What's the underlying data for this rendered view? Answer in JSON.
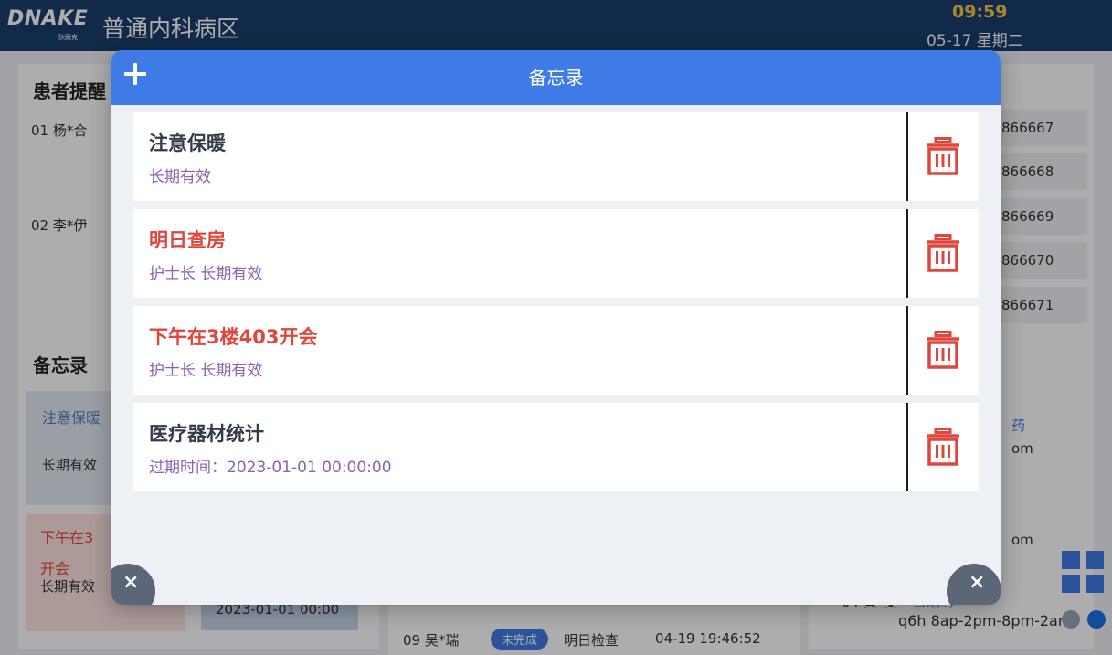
{
  "app": {
    "brand": "DNAKE",
    "brand_sub": "狄耐克",
    "ward_name": "普通内科病区",
    "time": "09:59",
    "date": "05-17 星期二"
  },
  "background": {
    "patient_section_title": "患者提醒",
    "patients": [
      "01 杨*合",
      "02 李*伊"
    ],
    "phones": [
      "866667",
      "866668",
      "866669",
      "866670",
      "866671"
    ],
    "memo_section_title": "备忘录",
    "memo_1_title": "注意保暖",
    "memo_1_sub": "长期有效",
    "memo_2_title_a": "下午在3",
    "memo_2_title_b": "开会",
    "memo_2_sub": "长期有效",
    "memo_2_time": "2023-01-01 00:00",
    "bed_row_name": "09 吴*瑞",
    "bed_row_status": "未完成",
    "bed_row_task": "明日检查",
    "bed_row_time": "04-19 19:46:52",
    "right_row_name": "04 黄*斐",
    "right_row_tag": "日晒药",
    "right_row_schedule": "q6h  8ap-2pm-8pm-2am",
    "right_pm_1": "om",
    "right_pm_2": "om",
    "right_tag_partial": "药"
  },
  "modal": {
    "title": "备忘录",
    "add_label": "+",
    "close_label": "×",
    "memos": [
      {
        "title": "注意保暖",
        "subtitle": "长期有效",
        "style": "normal"
      },
      {
        "title": "明日查房",
        "subtitle": "护士长   长期有效",
        "style": "urgent"
      },
      {
        "title": "下午在3楼403开会",
        "subtitle": "护士长   长期有效",
        "style": "urgent"
      },
      {
        "title": "医疗器材统计",
        "subtitle": "过期时间：2023-01-01 00:00:00",
        "style": "normal"
      }
    ]
  },
  "colors": {
    "header_blue": "#3e7be6",
    "urgent_red": "#e0463c",
    "subtitle_purple": "#8c63ae",
    "trash_red": "#e0463c"
  }
}
